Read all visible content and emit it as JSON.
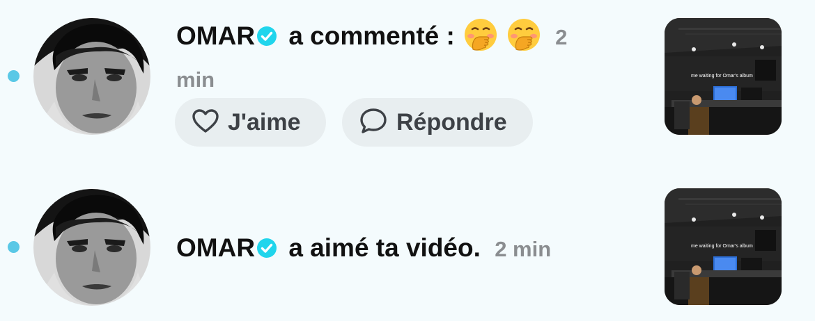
{
  "colors": {
    "background": "#f4fbfd",
    "unread_dot": "#5ac8e6",
    "verified_badge": "#20d5ec",
    "secondary_text": "#8a8d90",
    "button_bg": "#e8eef0"
  },
  "notifications": [
    {
      "username": "OMAR",
      "verified_icon": "verified-badge-icon",
      "action": "a commenté :",
      "emojis": [
        "hand-over-mouth-emoji",
        "hand-over-mouth-emoji"
      ],
      "time": "2 min",
      "like_label": "J'aime",
      "like_icon": "heart-outline-icon",
      "reply_label": "Répondre",
      "reply_icon": "speech-bubble-icon",
      "thumbnail_caption": "me waiting for Omar's album"
    },
    {
      "username": "OMAR",
      "verified_icon": "verified-badge-icon",
      "action": "a aimé ta vidéo.",
      "time": "2 min",
      "thumbnail_caption": "me waiting for Omar's album"
    }
  ]
}
